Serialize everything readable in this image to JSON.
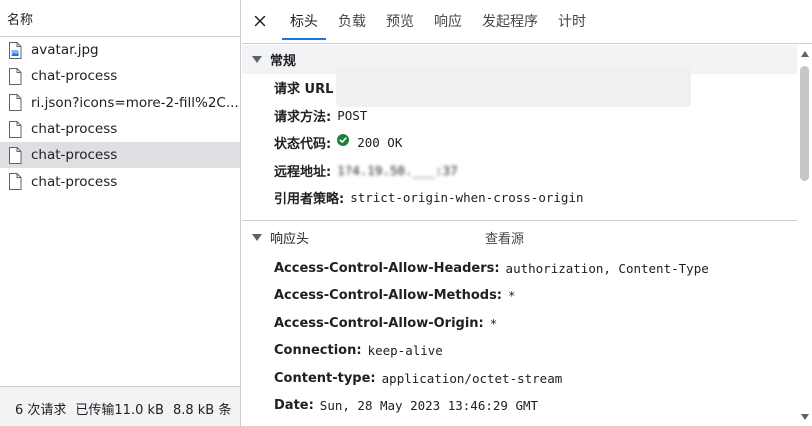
{
  "left_panel": {
    "header": "名称",
    "files": [
      {
        "name": "avatar.jpg",
        "icon": "image-file-icon",
        "selected": false
      },
      {
        "name": "chat-process",
        "icon": "file-icon",
        "selected": false
      },
      {
        "name": "ri.json?icons=more-2-fill%2C...",
        "icon": "file-icon",
        "selected": false
      },
      {
        "name": "chat-process",
        "icon": "file-icon",
        "selected": false
      },
      {
        "name": "chat-process",
        "icon": "file-icon",
        "selected": true
      },
      {
        "name": "chat-process",
        "icon": "file-icon",
        "selected": false
      }
    ],
    "footer": {
      "requests": "6 次请求",
      "transferred": "已传输11.0 kB",
      "resources": "8.8 kB 条"
    }
  },
  "tabs": [
    "标头",
    "负载",
    "预览",
    "响应",
    "发起程序",
    "计时"
  ],
  "active_tab": "标头",
  "general": {
    "title": "常规",
    "rows": [
      {
        "key": "请求 URL",
        "value": ""
      },
      {
        "key": "请求方法:",
        "value": "POST"
      },
      {
        "key": "状态代码:",
        "value": "200 OK",
        "icon": "status-ok-icon"
      },
      {
        "key": "远程地址:",
        "value": "1?4.19.50.___:37"
      },
      {
        "key": "引用者策略:",
        "value": "strict-origin-when-cross-origin"
      }
    ]
  },
  "response_headers": {
    "title": "响应头",
    "view_source": "查看源",
    "rows": [
      {
        "key": "Access-Control-Allow-Headers:",
        "value": "authorization, Content-Type"
      },
      {
        "key": "Access-Control-Allow-Methods:",
        "value": "*"
      },
      {
        "key": "Access-Control-Allow-Origin:",
        "value": "*"
      },
      {
        "key": "Connection:",
        "value": "keep-alive"
      },
      {
        "key": "Content-type:",
        "value": "application/octet-stream"
      },
      {
        "key": "Date:",
        "value": "Sun, 28 May 2023 13:46:29 GMT"
      }
    ]
  },
  "colors": {
    "accent": "#1a73e8",
    "status_ok": "#188038",
    "selected_row": "#dedfe2"
  }
}
